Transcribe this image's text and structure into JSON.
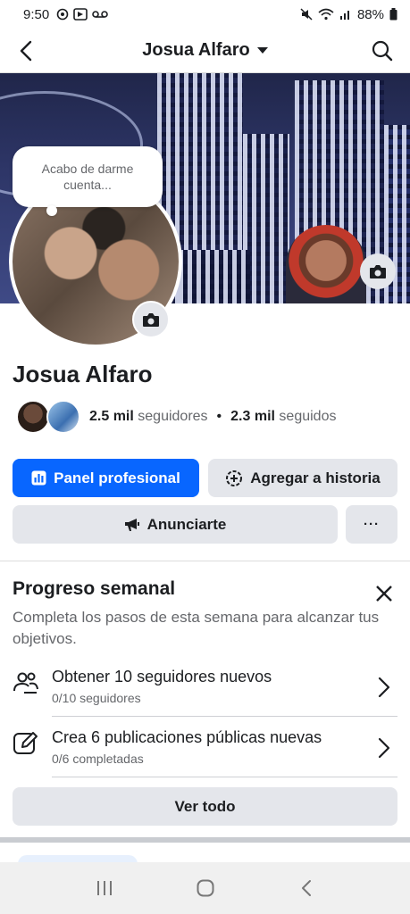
{
  "status_bar": {
    "time": "9:50",
    "battery": "88%",
    "icons": [
      "whatsapp-icon",
      "box-icon",
      "voicemail-icon",
      "mute-icon",
      "wifi-icon",
      "signal-icon",
      "battery-icon"
    ]
  },
  "header": {
    "title": "Josua Alfaro"
  },
  "profile": {
    "note": "Acabo de darme cuenta...",
    "name": "Josua Alfaro",
    "followers_count": "2.5 mil",
    "followers_label": "seguidores",
    "separator": "•",
    "following_count": "2.3 mil",
    "following_label": "seguidos"
  },
  "actions": {
    "panel_label": "Panel profesional",
    "story_label": "Agregar a historia",
    "advertise_label": "Anunciarte",
    "more_label": "···"
  },
  "weekly_progress": {
    "title": "Progreso semanal",
    "description": "Completa los pasos de esta semana para alcanzar tus objetivos.",
    "tasks": [
      {
        "title": "Obtener 10 seguidores nuevos",
        "subtitle": "0/10 seguidores",
        "progress": 0
      },
      {
        "title": "Crea 6 publicaciones públicas nuevas",
        "subtitle": "0/6 completadas",
        "progress": 0
      }
    ],
    "see_all_label": "Ver todo"
  },
  "colors": {
    "accent": "#0866ff",
    "secondary_button": "#e4e6eb",
    "text": "#1c1e21",
    "muted_text": "#65676b"
  }
}
